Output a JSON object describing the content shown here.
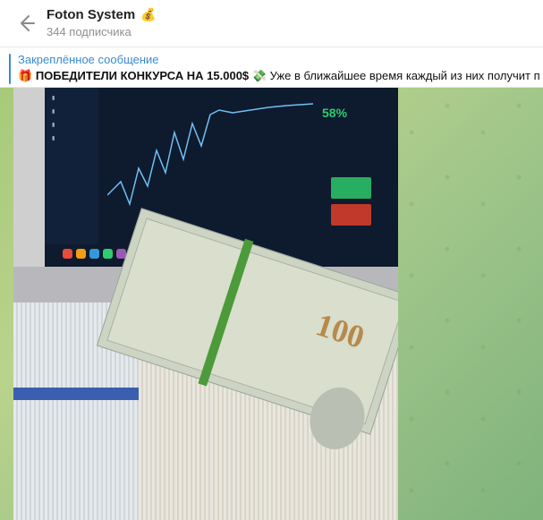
{
  "header": {
    "channel_name": "Foton System",
    "channel_emoji": "💰",
    "subscribers": "344 подписчика"
  },
  "pinned": {
    "label": "Закреплённое сообщение",
    "emoji_gift": "🎁",
    "headline": "ПОБЕДИТЕЛИ КОНКУРСА НА 15.000$",
    "emoji_money": "💸",
    "text": "Уже в ближайшее время каждый из них получит п"
  },
  "photo": {
    "screen_percent": "58%",
    "bill_denomination": "100"
  },
  "colors": {
    "accent": "#3a8bd1",
    "chat_bg": "#a8c97a"
  }
}
